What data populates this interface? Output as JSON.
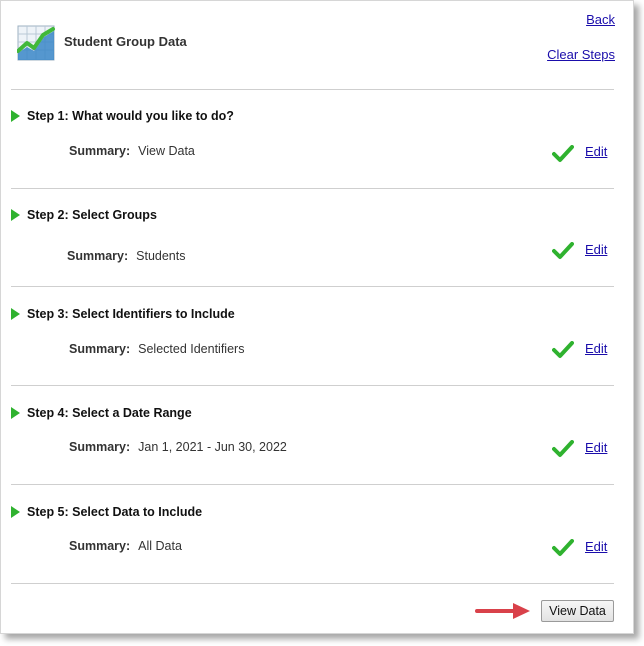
{
  "header": {
    "title": "Student Group Data",
    "back_label": "Back",
    "clear_steps_label": "Clear Steps"
  },
  "steps": [
    {
      "title": "Step 1: What would you like to do?",
      "summary_label": "Summary:",
      "summary_value": "View Data",
      "edit_label": "Edit"
    },
    {
      "title": "Step 2: Select Groups",
      "summary_label": "Summary:",
      "summary_value": "Students",
      "edit_label": "Edit"
    },
    {
      "title": "Step 3: Select Identifiers to Include",
      "summary_label": "Summary:",
      "summary_value": "Selected Identifiers",
      "edit_label": "Edit"
    },
    {
      "title": "Step 4: Select a Date Range",
      "summary_label": "Summary:",
      "summary_value": "Jan 1, 2021 - Jun 30, 2022",
      "edit_label": "Edit"
    },
    {
      "title": "Step 5: Select Data to Include",
      "summary_label": "Summary:",
      "summary_value": "All Data",
      "edit_label": "Edit"
    }
  ],
  "footer": {
    "view_data_label": "View Data"
  },
  "colors": {
    "link": "#1a0dab",
    "check": "#2fb22f",
    "arrow": "#d9414a"
  },
  "icons": {
    "logo": "chart-logo-icon",
    "step_marker": "triangle-right-icon",
    "complete": "checkmark-icon",
    "pointer": "arrow-right-icon"
  }
}
